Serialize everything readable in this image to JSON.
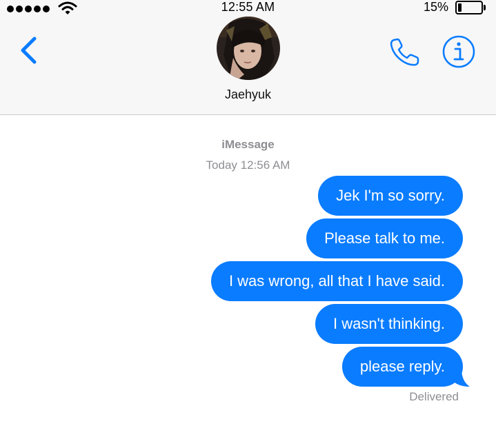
{
  "status_bar": {
    "time": "12:55 AM",
    "battery_percent": "15%",
    "battery_level": 0.15,
    "signal_bars": 5
  },
  "nav": {
    "contact_name": "Jaehyuk",
    "back_icon": "chevron-left-icon",
    "call_icon": "phone-icon",
    "info_icon": "info-icon"
  },
  "conversation": {
    "service_label": "iMessage",
    "timestamp_day": "Today",
    "timestamp_time": "12:56 AM",
    "messages": [
      {
        "sender": "me",
        "text": "Jek I'm so sorry."
      },
      {
        "sender": "me",
        "text": "Please talk to me."
      },
      {
        "sender": "me",
        "text": "I was wrong, all that I have said."
      },
      {
        "sender": "me",
        "text": "I wasn't thinking."
      },
      {
        "sender": "me",
        "text": "please reply."
      }
    ],
    "delivery_status": "Delivered"
  },
  "colors": {
    "accent": "#0a7cff",
    "bubble_text": "#ffffff",
    "meta_text": "#8e8e93",
    "header_bg": "#f7f7f7"
  }
}
